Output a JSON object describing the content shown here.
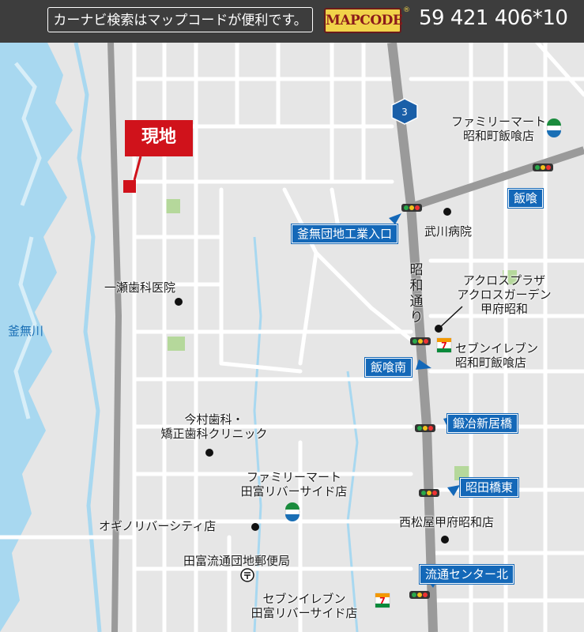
{
  "header": {
    "hint": "カーナビ検索はマップコードが便利です。",
    "logo": "MAPCODE",
    "logo_mark": "®",
    "code": "59 421 406*10"
  },
  "site_label": "現地",
  "route_number": "3",
  "road_name_vertical": "昭和通り",
  "river": "釜無川",
  "signs": {
    "iigui": "飯喰",
    "kamanashi_entrance": "釜無団地工業入口",
    "iigui_minami": "飯喰南",
    "kajishinikyo": "鍛冶新居橋",
    "shodabashi_higashi": "昭田橋東",
    "ryutsu_kita": "流通センター北"
  },
  "places": {
    "familymart_iigui_1": "ファミリーマート",
    "familymart_iigui_2": "昭和町飯喰店",
    "takekawa": "武川病院",
    "acros_1": "アクロスプラザ",
    "acros_2": "アクロスガーデン",
    "acros_3": "甲府昭和",
    "seven_iigui_1": "セブンイレブン",
    "seven_iigui_2": "昭和町飯喰店",
    "ichinose": "一瀬歯科医院",
    "imamura_1": "今村歯科・",
    "imamura_2": "矯正歯科クリニック",
    "familymart_tatomi_1": "ファミリーマート",
    "familymart_tatomi_2": "田富リバーサイド店",
    "okino": "オギノリバーシティ店",
    "nishimatsuya": "西松屋甲府昭和店",
    "post": "田富流通団地郵便局",
    "seven_tatomi_1": "セブンイレブン",
    "seven_tatomi_2": "田富リバーサイド店"
  },
  "colors": {
    "land": "#e6e6e6",
    "road": "#ffffff",
    "main_road": "#9a9a9a",
    "river": "#a8d8f0",
    "sign": "#1468b8",
    "site": "#d0121b",
    "park": "#b5d89b"
  },
  "icons": {
    "traffic_light": "traffic-light-icon",
    "familymart": "familymart-logo-icon",
    "seven_eleven": "seven-eleven-logo-icon",
    "post_office": "post-office-icon",
    "poi": "poi-dot-icon",
    "route": "route-shield-icon"
  }
}
